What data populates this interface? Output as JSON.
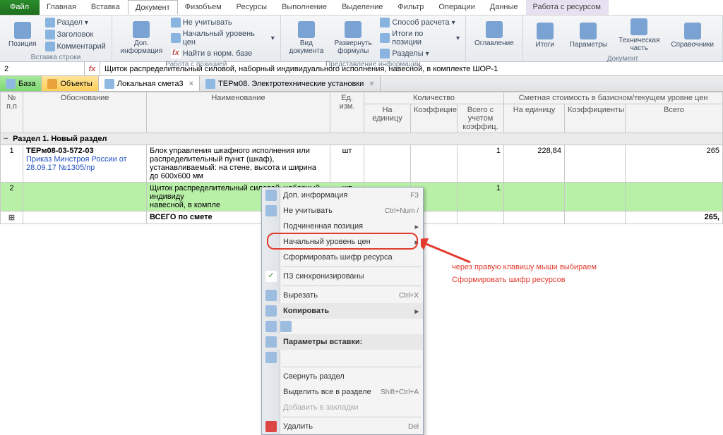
{
  "tabs": {
    "file": "Файл",
    "home": "Главная",
    "insert": "Вставка",
    "document": "Документ",
    "fizobem": "Физобъем",
    "resources": "Ресурсы",
    "execution": "Выполнение",
    "selection": "Выделение",
    "filter": "Фильтр",
    "operations": "Операции",
    "data": "Данные",
    "rabota": "Работа с ресурсом"
  },
  "ribbon": {
    "grp_vstavka": "Вставка строки",
    "pozitsiya": "Позиция",
    "razdel": "Раздел",
    "zagolovok": "Заголовок",
    "kommentariy": "Комментарий",
    "grp_rabota": "Работа с позицией",
    "dopinfo": "Доп.\nинформация",
    "neuchityvat": "Не учитывать",
    "nachuroven": "Начальный уровень цен",
    "naitinorm": "Найти в норм. базе",
    "grp_predstav": "Представление информации",
    "viddok": "Вид\nдокумента",
    "razvernut": "Развернуть\nформулы",
    "sposob": "Способ расчета",
    "itogipoz": "Итоги по позиции",
    "razdely": "Разделы",
    "oglavlenie": "Оглавление",
    "grp_dokument": "Документ",
    "itogi": "Итоги",
    "parametry": "Параметры",
    "techchast": "Техническая\nчасть",
    "spravochniki": "Справочники"
  },
  "formula": {
    "cell": "2",
    "text": "Щиток распределительный силовой, наборный индивидуального исполнения, навесной, в комплекте ШОР-1"
  },
  "doctabs": {
    "baza": "База",
    "objekty": "Объекты",
    "smeta": "Локальная смета3",
    "term": "ТЕРм08. Электротехнические установки"
  },
  "grid": {
    "hdr_num": "№\nп.п",
    "hdr_obosn": "Обоснование",
    "hdr_name": "Наименование",
    "hdr_ed": "Ед. изм.",
    "hdr_kol": "Количество",
    "hdr_smet": "Сметная стоимость в базисном/текущем уровне цен",
    "hdr_na_ed": "На\nединицу",
    "hdr_koef": "Коэффициенты",
    "hdr_vsego_uch": "Всего с\nучетом\nкоэффиц.",
    "hdr_s_na_ed": "На единицу",
    "hdr_s_koef": "Коэффициенты",
    "hdr_s_vsego": "Всего",
    "section": "Раздел 1. Новый раздел",
    "row1_num": "1",
    "row1_obosn": "ТЕРм08-03-572-03",
    "row1_prikaz": "Приказ Минстроя России от 28.09.17 №1305/пр",
    "row1_name": "Блок управления шкафного исполнения или распределительный пункт (шкаф), устанавливаемый: на стене, высота и ширина до 600х600 мм",
    "row1_ed": "шт",
    "row1_kol": "1",
    "row1_naed": "228,84",
    "row1_vsego": "265",
    "row2_num": "2",
    "row2_name": "Щиток распределительный силовой, наборный индивиду\nнавесной, в компле",
    "row2_ed": "шт",
    "row2_kol": "1",
    "total": "ВСЕГО по смете",
    "total_v": "265,"
  },
  "ctx": {
    "dopinfo": "Доп. информация",
    "dopinfo_sc": "F3",
    "neuchit": "Не учитывать",
    "neuchit_sc": "Ctrl+Num /",
    "podchin": "Подчиненная позиция",
    "nachur": "Начальный уровень цен",
    "sform": "Сформировать шифр ресурса",
    "pzsync": "ПЗ синхронизированы",
    "vyrezat": "Вырезать",
    "vyrezat_sc": "Ctrl+X",
    "kopir": "Копировать",
    "paramv": "Параметры вставки:",
    "svernut": "Свернуть раздел",
    "vydelit": "Выделить все в разделе",
    "vydelit_sc": "Shift+Ctrl+A",
    "dobavit": "Добавить в закладки",
    "udalit": "Удалить",
    "udalit_sc": "Del"
  },
  "annot": {
    "line1": "через правую клавишу мыши выбираем",
    "line2": "Сформировать шифр ресурсов"
  }
}
